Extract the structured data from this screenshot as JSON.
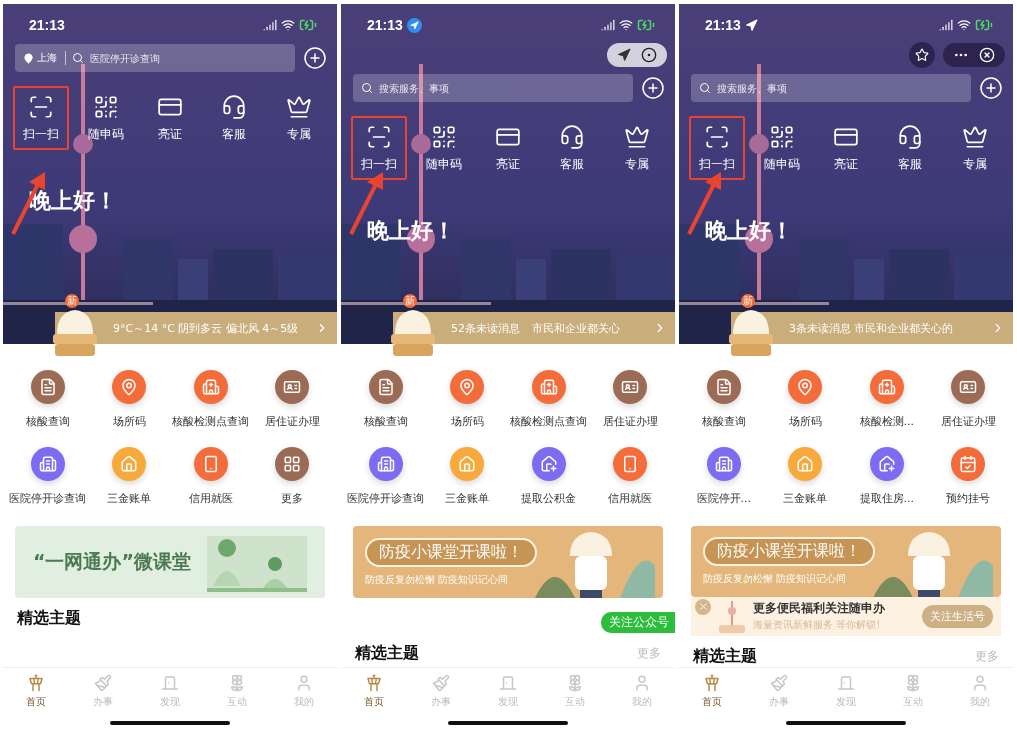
{
  "phones": [
    {
      "status": {
        "time": "21:13"
      },
      "search": {
        "city": "上海",
        "placeholder": "医院停开诊查询"
      },
      "actions": [
        {
          "label": "扫一扫",
          "kind": "scan",
          "highlighted": true
        },
        {
          "label": "随申码",
          "kind": "qr",
          "highlighted": false
        },
        {
          "label": "亮证",
          "kind": "card",
          "highlighted": false
        },
        {
          "label": "客服",
          "kind": "service",
          "highlighted": false
        },
        {
          "label": "专属",
          "kind": "crown",
          "highlighted": false
        }
      ],
      "greeting": "晚上好！",
      "ticker": {
        "badge": "新",
        "items": [
          "9°C～14 °C 阴到多云 偏北风 4～5级"
        ]
      },
      "services": [
        {
          "label": "核酸查询",
          "kind": "doc",
          "color": "#9c6b55"
        },
        {
          "label": "场所码",
          "kind": "pin",
          "color": "#f56c3b"
        },
        {
          "label": "核酸检测点查询",
          "kind": "hospital",
          "color": "#f56c3b"
        },
        {
          "label": "居住证办理",
          "kind": "idcard",
          "color": "#9c6b55"
        },
        {
          "label": "医院停开诊查询",
          "kind": "building",
          "color": "#7d6cf2"
        },
        {
          "label": "三金账单",
          "kind": "bill",
          "color": "#f7a93c"
        },
        {
          "label": "信用就医",
          "kind": "phone",
          "color": "#f56c3b"
        },
        {
          "label": "更多",
          "kind": "more",
          "color": "#9c6b55"
        }
      ],
      "promo": {
        "kind": "course",
        "title": "“一网通办”微课堂"
      },
      "section": {
        "title": "精选主题"
      },
      "tabs": [
        {
          "label": "首页",
          "kind": "home",
          "selected": true
        },
        {
          "label": "办事",
          "kind": "work",
          "selected": false
        },
        {
          "label": "发现",
          "kind": "discover",
          "selected": false
        },
        {
          "label": "互动",
          "kind": "interact",
          "selected": false
        },
        {
          "label": "我的",
          "kind": "mine",
          "selected": false
        }
      ]
    },
    {
      "status": {
        "time": "21:13",
        "kind": "badge"
      },
      "capsule": {
        "kind": "locate"
      },
      "search": {
        "placeholder": "搜索服务、事项"
      },
      "actions": [
        {
          "label": "扫一扫",
          "kind": "scan",
          "highlighted": true
        },
        {
          "label": "随申码",
          "kind": "qr",
          "highlighted": false
        },
        {
          "label": "亮证",
          "kind": "card",
          "highlighted": false
        },
        {
          "label": "客服",
          "kind": "service",
          "highlighted": false
        },
        {
          "label": "专属",
          "kind": "crown",
          "highlighted": false
        }
      ],
      "greeting": "晚上好！",
      "ticker": {
        "badge": "新",
        "items": [
          "52条未读消息",
          "市民和企业都关心"
        ]
      },
      "services": [
        {
          "label": "核酸查询",
          "kind": "doc",
          "color": "#9c6b55"
        },
        {
          "label": "场所码",
          "kind": "pin",
          "color": "#f56c3b"
        },
        {
          "label": "核酸检测点查询",
          "kind": "hospital",
          "color": "#f56c3b"
        },
        {
          "label": "居住证办理",
          "kind": "idcard",
          "color": "#9c6b55"
        },
        {
          "label": "医院停开诊查询",
          "kind": "building",
          "color": "#7d6cf2"
        },
        {
          "label": "三金账单",
          "kind": "bill",
          "color": "#f7a93c"
        },
        {
          "label": "提取公积金",
          "kind": "fund",
          "color": "#7d6cf2"
        },
        {
          "label": "信用就医",
          "kind": "phone",
          "color": "#f56c3b"
        }
      ],
      "promo": {
        "kind": "epidemic",
        "title": "防疫小课堂开课啦！",
        "subtitle": "防疫反复勿松懈 防疫知识记心间"
      },
      "follow_tag": "关注公众号",
      "section": {
        "title": "精选主题",
        "more": "更多"
      },
      "tabs": [
        {
          "label": "首页",
          "kind": "home",
          "selected": true
        },
        {
          "label": "办事",
          "kind": "work",
          "selected": false
        },
        {
          "label": "发现",
          "kind": "discover",
          "selected": false
        },
        {
          "label": "互动",
          "kind": "interact",
          "selected": false
        },
        {
          "label": "我的",
          "kind": "mine",
          "selected": false
        }
      ]
    },
    {
      "status": {
        "time": "21:13",
        "kind": "plain"
      },
      "capsule": {
        "kind": "menu"
      },
      "search": {
        "placeholder": "搜索服务、事项"
      },
      "actions": [
        {
          "label": "扫一扫",
          "kind": "scan",
          "highlighted": true
        },
        {
          "label": "随申码",
          "kind": "qr",
          "highlighted": false
        },
        {
          "label": "亮证",
          "kind": "card",
          "highlighted": false
        },
        {
          "label": "客服",
          "kind": "service",
          "highlighted": false
        },
        {
          "label": "专属",
          "kind": "crown",
          "highlighted": false
        }
      ],
      "greeting": "晚上好！",
      "ticker": {
        "badge": "新",
        "items": [
          "3条未读消息 市民和企业都关心的"
        ]
      },
      "services": [
        {
          "label": "核酸查询",
          "kind": "doc",
          "color": "#9c6b55"
        },
        {
          "label": "场所码",
          "kind": "pin",
          "color": "#f56c3b"
        },
        {
          "label": "核酸检测...",
          "kind": "hospital",
          "color": "#f56c3b"
        },
        {
          "label": "居住证办理",
          "kind": "idcard",
          "color": "#9c6b55"
        },
        {
          "label": "医院停开...",
          "kind": "building",
          "color": "#7d6cf2"
        },
        {
          "label": "三金账单",
          "kind": "bill",
          "color": "#f7a93c"
        },
        {
          "label": "提取住房...",
          "kind": "fund",
          "color": "#7d6cf2"
        },
        {
          "label": "预约挂号",
          "kind": "calendar",
          "color": "#f56c3b"
        }
      ],
      "promo": {
        "kind": "epidemic",
        "title": "防疫小课堂开课啦！",
        "subtitle": "防疫反复勿松懈 防疫知识记心间"
      },
      "follow_bar": {
        "title": "更多便民福利关注随申办",
        "subtitle": "海量资讯新鲜服务 等你解锁!",
        "button": "关注生活号"
      },
      "section": {
        "title": "精选主题",
        "more": "更多"
      },
      "tabs": [
        {
          "label": "首页",
          "kind": "home",
          "selected": true
        },
        {
          "label": "办事",
          "kind": "work",
          "selected": false
        },
        {
          "label": "发现",
          "kind": "discover",
          "selected": false
        },
        {
          "label": "互动",
          "kind": "interact",
          "selected": false
        },
        {
          "label": "我的",
          "kind": "mine",
          "selected": false
        }
      ]
    }
  ]
}
